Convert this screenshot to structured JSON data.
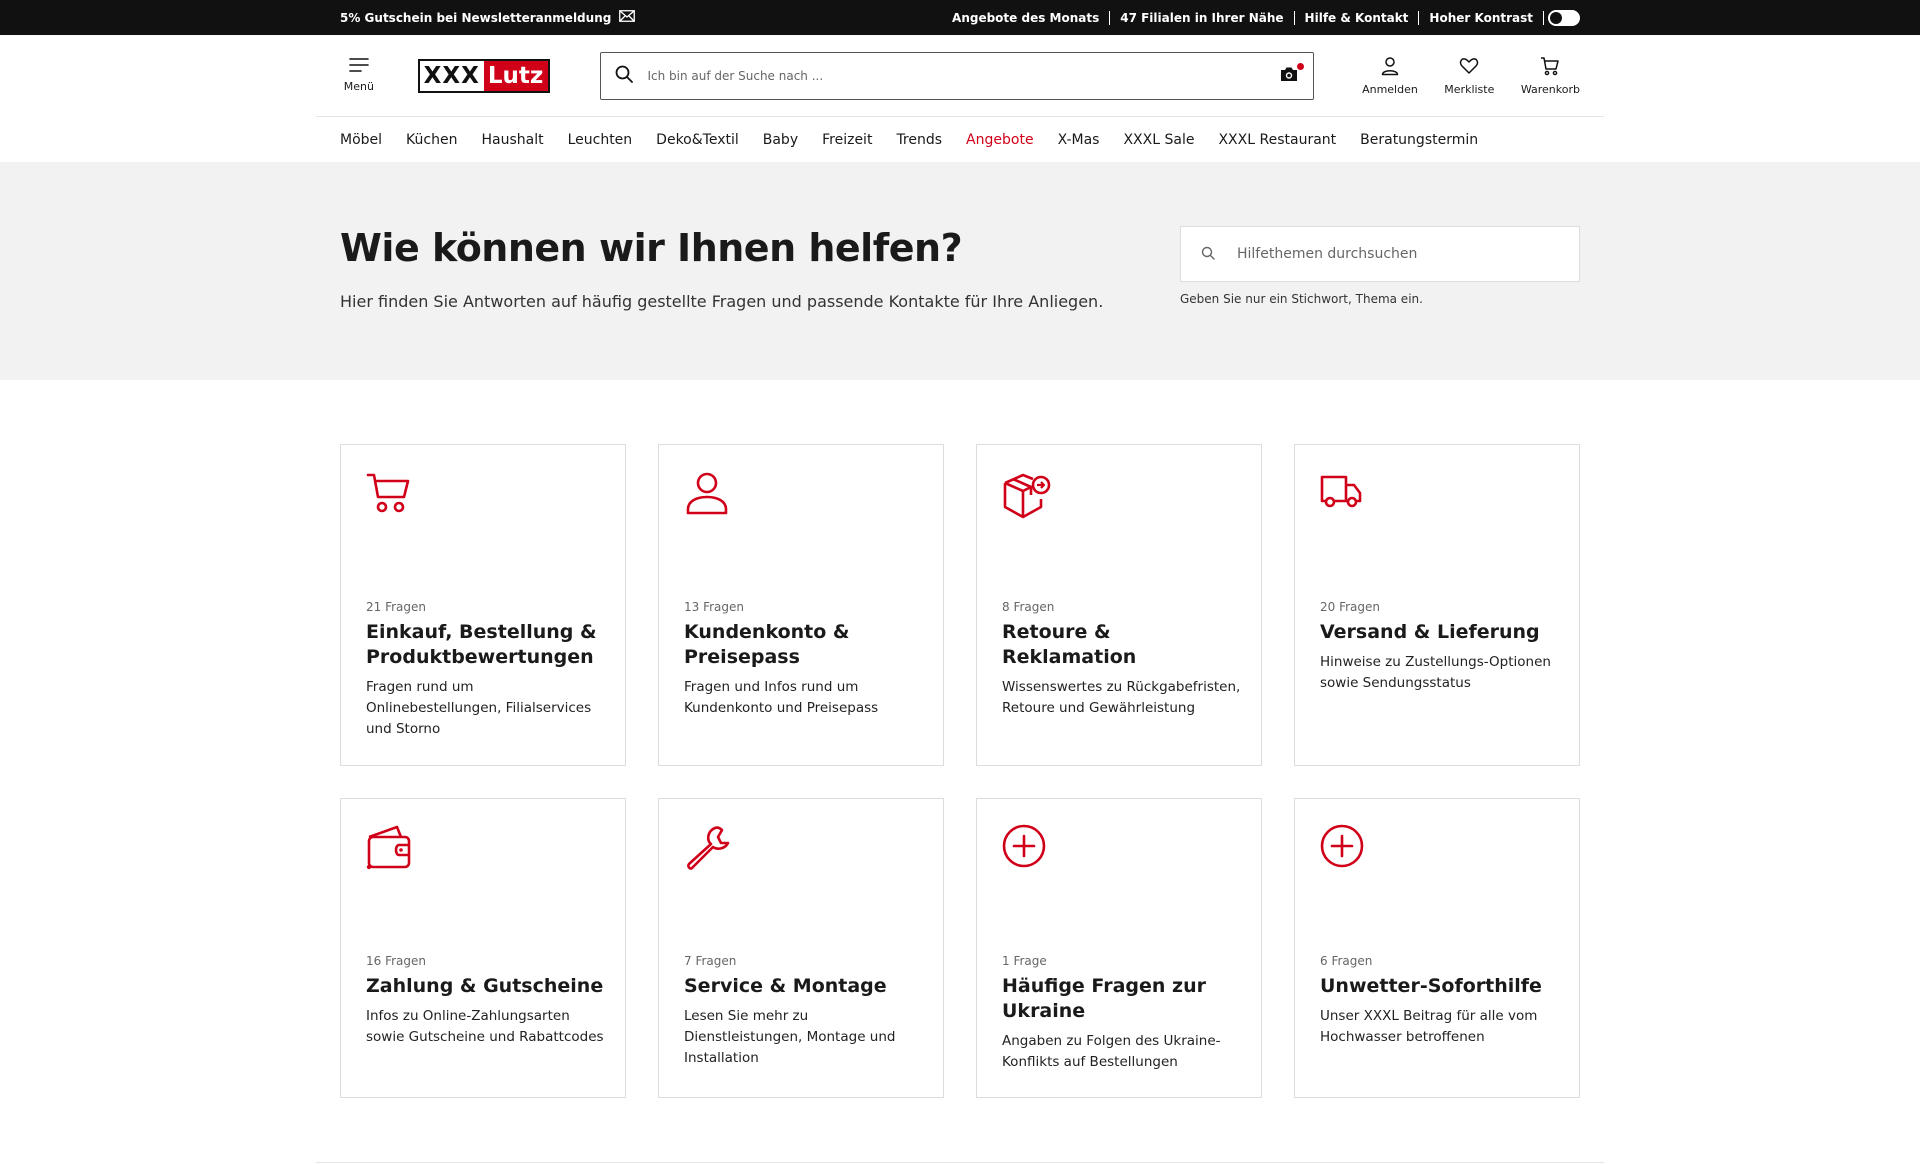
{
  "topbar": {
    "promo": "5% Gutschein bei Newsletteranmeldung",
    "links": [
      "Angebote des Monats",
      "47 Filialen in Ihrer Nähe",
      "Hilfe & Kontakt",
      "Hoher Kontrast"
    ]
  },
  "header": {
    "menu_label": "Menü",
    "logo_left": "XXX",
    "logo_right": "Lutz",
    "search_placeholder": "Ich bin auf der Suche nach ...",
    "actions": [
      "Anmelden",
      "Merkliste",
      "Warenkorb"
    ]
  },
  "nav": [
    "Möbel",
    "Küchen",
    "Haushalt",
    "Leuchten",
    "Deko&Textil",
    "Baby",
    "Freizeit",
    "Trends",
    "Angebote",
    "X-Mas",
    "XXXL Sale",
    "XXXL Restaurant",
    "Beratungstermin"
  ],
  "hero": {
    "title": "Wie können wir Ihnen helfen?",
    "subtitle": "Hier finden Sie Antworten auf häufig gestellte Fragen und passende Kontakte für Ihre Anliegen.",
    "search_placeholder": "Hilfethemen durchsuchen",
    "search_hint": "Geben Sie nur ein Stichwort, Thema ein."
  },
  "cards": [
    {
      "count": "21 Fragen",
      "title": "Einkauf, Bestellung & Produktbewertungen",
      "desc": "Fragen rund um Onlinebestellungen, Filialservices und Storno",
      "icon": "cart-icon"
    },
    {
      "count": "13 Fragen",
      "title": "Kundenkonto & Preisepass",
      "desc": "Fragen und Infos rund um Kundenkonto und Preisepass",
      "icon": "user-icon"
    },
    {
      "count": "8 Fragen",
      "title": "Retoure & Reklamation",
      "desc": "Wissenswertes zu Rückgabefristen, Retoure und Gewährleistung",
      "icon": "return-box-icon"
    },
    {
      "count": "20 Fragen",
      "title": "Versand & Lieferung",
      "desc": "Hinweise zu Zustellungs-Optionen sowie Sendungsstatus",
      "icon": "truck-icon"
    },
    {
      "count": "16 Fragen",
      "title": "Zahlung & Gutscheine",
      "desc": "Infos zu Online-Zahlungsarten sowie Gutscheine und Rabattcodes",
      "icon": "wallet-icon"
    },
    {
      "count": "7 Fragen",
      "title": "Service & Montage",
      "desc": "Lesen Sie mehr zu Dienstleistungen, Montage und Installation",
      "icon": "wrench-icon"
    },
    {
      "count": "1 Frage",
      "title": "Häufige Fragen zur Ukraine",
      "desc": "Angaben zu Folgen des Ukraine-Konflikts auf Bestellungen",
      "icon": "plus-circle-icon"
    },
    {
      "count": "6 Fragen",
      "title": "Unwetter-Soforthilfe",
      "desc": "Unser XXXL Beitrag für alle vom Hochwasser betroffenen",
      "icon": "plus-circle-icon"
    }
  ],
  "colors": {
    "accent": "#d10019",
    "topbar": "#111111",
    "hero_bg": "#f2f2f2"
  }
}
